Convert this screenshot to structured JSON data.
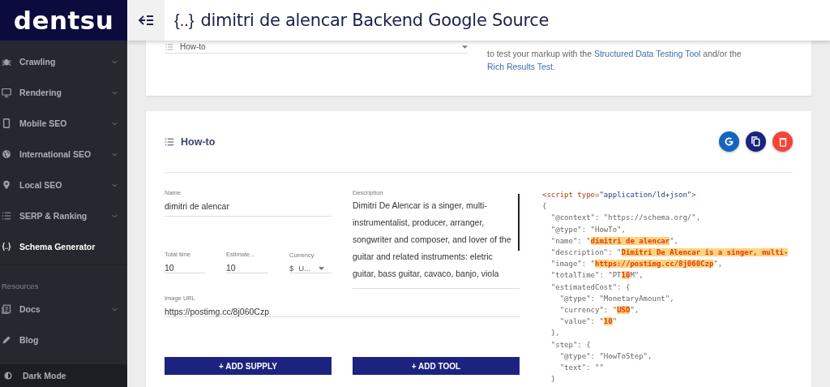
{
  "sidebar": {
    "logo": "dentsu",
    "items": [
      {
        "label": "Crawling",
        "expandable": true,
        "selected": false
      },
      {
        "label": "Rendering",
        "expandable": true,
        "selected": false
      },
      {
        "label": "Mobile SEO",
        "expandable": true,
        "selected": false
      },
      {
        "label": "International SEO",
        "expandable": true,
        "selected": false
      },
      {
        "label": "Local SEO",
        "expandable": true,
        "selected": false
      },
      {
        "label": "SERP & Ranking",
        "expandable": true,
        "selected": false
      },
      {
        "label": "Schema Generator",
        "expandable": false,
        "selected": true
      }
    ],
    "section_label": "Resources",
    "resources": [
      {
        "label": "Docs",
        "expandable": true
      },
      {
        "label": "Blog",
        "expandable": false
      }
    ],
    "dark_mode": {
      "label": "Dark Mode"
    }
  },
  "header": {
    "icon_text": "{..}",
    "title": "dimitri de alencar Backend Google Source"
  },
  "type_card": {
    "select": {
      "value": "How-to"
    },
    "info": {
      "text_before": "to test your markup with the",
      "link_1": "Structured Data Testing Tool",
      "text_middle": "and/or the",
      "link_2": "Rich Results Test",
      "text_after": "."
    }
  },
  "howto_card": {
    "title": "How-to",
    "actions": [
      {
        "kind": "google",
        "color": "#1565c0"
      },
      {
        "kind": "copy",
        "color": "#1a237e"
      },
      {
        "kind": "delete",
        "color": "#f44336"
      }
    ],
    "name": {
      "label": "Name",
      "value": "dimitri de alencar"
    },
    "total_time": {
      "label": "Total time",
      "value": "10"
    },
    "estimate": {
      "label": "Estimate...",
      "value": "10"
    },
    "currency": {
      "label": "Currency",
      "symbol": "$",
      "value": "U..."
    },
    "description": {
      "label": "Description",
      "value": "Dimitri De Alencar is a singer, multi-instrumentalist, producer, arranger, songwriter and composer, and lover of the guitar and related instruments: eletric guitar, bass guitar, cavaco, banjo, viola"
    },
    "image_url": {
      "label": "Image URL",
      "value": "https://postimg.cc/8j060Czp"
    },
    "buttons": [
      "+ ADD SUPPLY",
      "+ ADD TOOL"
    ],
    "code": [
      [
        {
          "kind": "tag",
          "text": "<script "
        },
        {
          "kind": "attr",
          "text": "type="
        },
        {
          "kind": "str",
          "text": "\"application/ld+json\""
        },
        {
          "kind": "tag",
          "text": ">"
        }
      ],
      [
        {
          "kind": "plain",
          "text": "{"
        }
      ],
      [
        {
          "kind": "plain",
          "text": "  \"@context\": \"https://schema.org/\","
        }
      ],
      [
        {
          "kind": "plain",
          "text": "  \"@type\": \"HowTo\","
        }
      ],
      [
        {
          "kind": "plain",
          "text": "  \"name\": \""
        },
        {
          "kind": "mark",
          "text": "dimitri de alencar"
        },
        {
          "kind": "plain",
          "text": "\","
        }
      ],
      [
        {
          "kind": "plain",
          "text": "  \"description\": \""
        },
        {
          "kind": "mark",
          "text": "Dimitri De Alencar is a singer, multi-"
        }
      ],
      [
        {
          "kind": "plain",
          "text": "  \"image\": \""
        },
        {
          "kind": "mark",
          "text": "https://postimg.cc/8j060Czp"
        },
        {
          "kind": "plain",
          "text": "\","
        }
      ],
      [
        {
          "kind": "plain",
          "text": "  \"totalTime\": \"PT"
        },
        {
          "kind": "mark",
          "text": "10"
        },
        {
          "kind": "plain",
          "text": "M\","
        }
      ],
      [
        {
          "kind": "plain",
          "text": "  \"estimatedCost\": {"
        }
      ],
      [
        {
          "kind": "plain",
          "text": "    \"@type\": \"MonetaryAmount\","
        }
      ],
      [
        {
          "kind": "plain",
          "text": "    \"currency\": \""
        },
        {
          "kind": "mark",
          "text": "USD"
        },
        {
          "kind": "plain",
          "text": "\","
        }
      ],
      [
        {
          "kind": "plain",
          "text": "    \"value\": \""
        },
        {
          "kind": "mark",
          "text": "10"
        },
        {
          "kind": "plain",
          "text": "\""
        }
      ],
      [
        {
          "kind": "plain",
          "text": "  },"
        }
      ],
      [
        {
          "kind": "plain",
          "text": "  \"step\": {"
        }
      ],
      [
        {
          "kind": "plain",
          "text": "    \"@type\": \"HowToStep\","
        }
      ],
      [
        {
          "kind": "plain",
          "text": "    \"text\": \"\""
        }
      ],
      [
        {
          "kind": "plain",
          "text": "  }"
        }
      ]
    ]
  }
}
